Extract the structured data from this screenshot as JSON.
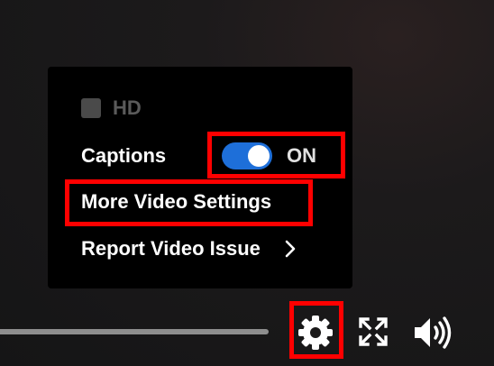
{
  "settings_menu": {
    "hd_label": "HD",
    "hd_checked": false,
    "captions_label": "Captions",
    "captions_toggle": {
      "state_label": "ON",
      "on": true
    },
    "more_settings_label": "More Video Settings",
    "report_issue_label": "Report Video Issue"
  },
  "controls": {
    "icons": [
      "gear-icon",
      "fullscreen-icon",
      "volume-icon"
    ]
  },
  "colors": {
    "toggle_on": "#1e6fd9",
    "highlight": "#ff0000",
    "menu_background": "#000000"
  }
}
